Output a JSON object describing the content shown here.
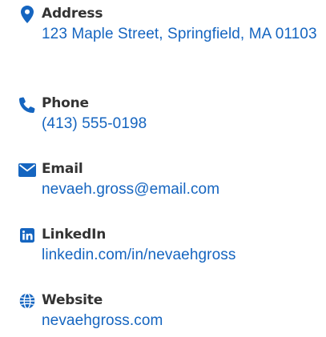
{
  "accent_color": "#1565c0",
  "contacts": [
    {
      "icon": "map-pin-icon",
      "label": "Address",
      "value": "123 Maple Street, Springfield, MA 01103"
    },
    {
      "icon": "phone-icon",
      "label": "Phone",
      "value": "(413) 555-0198"
    },
    {
      "icon": "envelope-icon",
      "label": "Email",
      "value": "nevaeh.gross@email.com"
    },
    {
      "icon": "linkedin-icon",
      "label": "LinkedIn",
      "value": "linkedin.com/in/nevaehgross"
    },
    {
      "icon": "globe-icon",
      "label": "Website",
      "value": "nevaehgross.com"
    }
  ]
}
